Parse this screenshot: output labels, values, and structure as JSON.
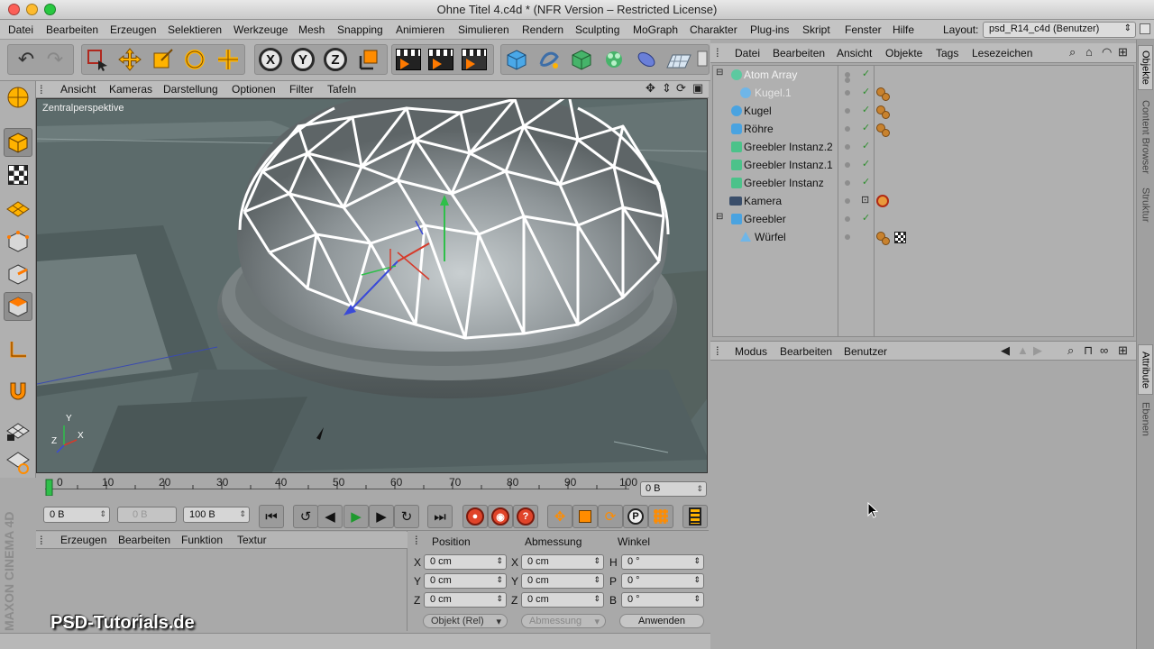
{
  "window": {
    "title": "Ohne Titel 4.c4d * (NFR Version – Restricted License)"
  },
  "menubar": {
    "items": [
      "Datei",
      "Bearbeiten",
      "Erzeugen",
      "Selektieren",
      "Werkzeuge",
      "Mesh",
      "Snapping",
      "Animieren",
      "Simulieren",
      "Rendern",
      "Sculpting",
      "MoGraph",
      "Charakter",
      "Plug-ins",
      "Skript",
      "Fenster",
      "Hilfe"
    ],
    "layout_label": "Layout:",
    "layout_value": "psd_R14_c4d (Benutzer)"
  },
  "viewport": {
    "menus": [
      "Ansicht",
      "Kameras",
      "Darstellung",
      "Optionen",
      "Filter",
      "Tafeln"
    ],
    "camera_label": "Zentralperspektive",
    "axis_y": "Y",
    "axis_x": "X",
    "axis_z": "Z"
  },
  "timeline": {
    "ticks": [
      "0",
      "10",
      "20",
      "30",
      "40",
      "50",
      "60",
      "70",
      "80",
      "90",
      "100"
    ],
    "current_frame": "0 B"
  },
  "transport": {
    "start_field": "0 B",
    "preview_field": "0 B",
    "end_field": "100 B"
  },
  "material_manager": {
    "menus": [
      "Erzeugen",
      "Bearbeiten",
      "Funktion",
      "Textur"
    ]
  },
  "branding": {
    "maxon": "MAXON CINEMA 4D",
    "watermark": "PSD-Tutorials.de"
  },
  "coordinates": {
    "headers": [
      "Position",
      "Abmessung",
      "Winkel"
    ],
    "rows": [
      {
        "l1": "X",
        "v1": "0 cm",
        "l2": "X",
        "v2": "0 cm",
        "l3": "H",
        "v3": "0 °"
      },
      {
        "l1": "Y",
        "v1": "0 cm",
        "l2": "Y",
        "v2": "0 cm",
        "l3": "P",
        "v3": "0 °"
      },
      {
        "l1": "Z",
        "v1": "0 cm",
        "l2": "Z",
        "v2": "0 cm",
        "l3": "B",
        "v3": "0 °"
      }
    ],
    "mode_dropdown": "Objekt (Rel)",
    "size_dropdown": "Abmessung",
    "apply_button": "Anwenden"
  },
  "object_manager": {
    "menus": [
      "Datei",
      "Bearbeiten",
      "Ansicht",
      "Objekte",
      "Tags",
      "Lesezeichen"
    ],
    "objects": [
      {
        "name": "Atom Array",
        "indent": 0,
        "icon_color": "#5cc9a0",
        "expander": "−",
        "style": "hl",
        "tags": 0
      },
      {
        "name": "Kugel.1",
        "indent": 1,
        "icon_color": "#6fb6e8",
        "expander": "",
        "style": "sub",
        "tags": 1
      },
      {
        "name": "Kugel",
        "indent": 0,
        "icon_color": "#4aa3e0",
        "expander": "",
        "style": "",
        "tags": 1
      },
      {
        "name": "Röhre",
        "indent": 0,
        "icon_color": "#4aa3e0",
        "expander": "",
        "style": "",
        "tags": 1
      },
      {
        "name": "Greebler Instanz.2",
        "indent": 0,
        "icon_color": "#4cc28a",
        "expander": "",
        "style": "",
        "tags": 0
      },
      {
        "name": "Greebler Instanz.1",
        "indent": 0,
        "icon_color": "#4cc28a",
        "expander": "",
        "style": "",
        "tags": 0
      },
      {
        "name": "Greebler Instanz",
        "indent": 0,
        "icon_color": "#4cc28a",
        "expander": "",
        "style": "",
        "tags": 0
      },
      {
        "name": "Kamera",
        "indent": 0,
        "icon_color": "#3a4e6a",
        "expander": "",
        "style": "",
        "tags": 2
      },
      {
        "name": "Greebler",
        "indent": 0,
        "icon_color": "#4aa3e0",
        "expander": "−",
        "style": "",
        "tags": 0
      },
      {
        "name": "Würfel",
        "indent": 1,
        "icon_color": "#6fb6e8",
        "expander": "",
        "style": "",
        "tags": 3
      }
    ]
  },
  "attributes_manager": {
    "menus": [
      "Modus",
      "Bearbeiten",
      "Benutzer"
    ]
  },
  "right_tabs": [
    "Objekte",
    "Content Browser",
    "Struktur",
    "Attribute",
    "Ebenen"
  ],
  "colors": {
    "accent_orange": "#ff7a00",
    "panel_gray": "#a9a9a9",
    "viewport_bg": "#5a6a69"
  }
}
